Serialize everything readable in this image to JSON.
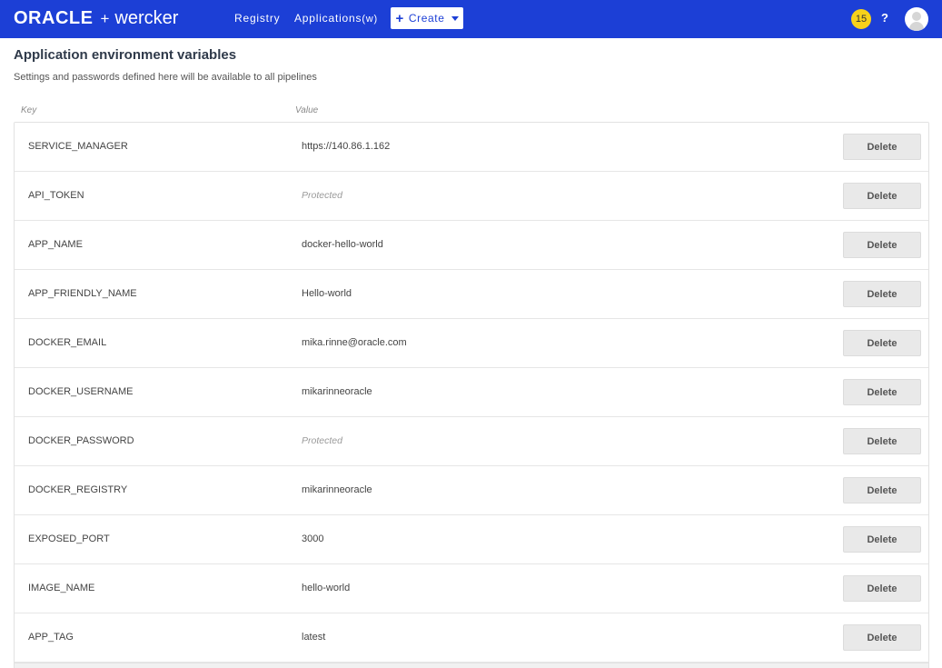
{
  "header": {
    "brand_oracle": "ORACLE",
    "brand_plus": "+",
    "brand_wercker": "wercker",
    "nav": {
      "registry": "Registry",
      "applications": "Applications",
      "applications_shortcut": "(w)"
    },
    "create_label": "Create",
    "notifications_count": "15",
    "help_label": "?"
  },
  "page": {
    "title": "Application environment variables",
    "subtitle": "Settings and passwords defined here will be available to all pipelines"
  },
  "table": {
    "columns": {
      "key": "Key",
      "value": "Value"
    },
    "delete_label": "Delete",
    "rows": [
      {
        "key": "SERVICE_MANAGER",
        "value": "https://140.86.1.162",
        "protected": false
      },
      {
        "key": "API_TOKEN",
        "value": "Protected",
        "protected": true
      },
      {
        "key": "APP_NAME",
        "value": "docker-hello-world",
        "protected": false
      },
      {
        "key": "APP_FRIENDLY_NAME",
        "value": "Hello-world",
        "protected": false
      },
      {
        "key": "DOCKER_EMAIL",
        "value": "mika.rinne@oracle.com",
        "protected": false
      },
      {
        "key": "DOCKER_USERNAME",
        "value": "mikarinneoracle",
        "protected": false
      },
      {
        "key": "DOCKER_PASSWORD",
        "value": "Protected",
        "protected": true
      },
      {
        "key": "DOCKER_REGISTRY",
        "value": "mikarinneoracle",
        "protected": false
      },
      {
        "key": "EXPOSED_PORT",
        "value": "3000",
        "protected": false
      },
      {
        "key": "IMAGE_NAME",
        "value": "hello-world",
        "protected": false
      },
      {
        "key": "APP_TAG",
        "value": "latest",
        "protected": false
      }
    ]
  },
  "colors": {
    "topbar": "#1c3fd6",
    "badge": "#f7d11a",
    "delete_button": "#e9e9e9"
  }
}
